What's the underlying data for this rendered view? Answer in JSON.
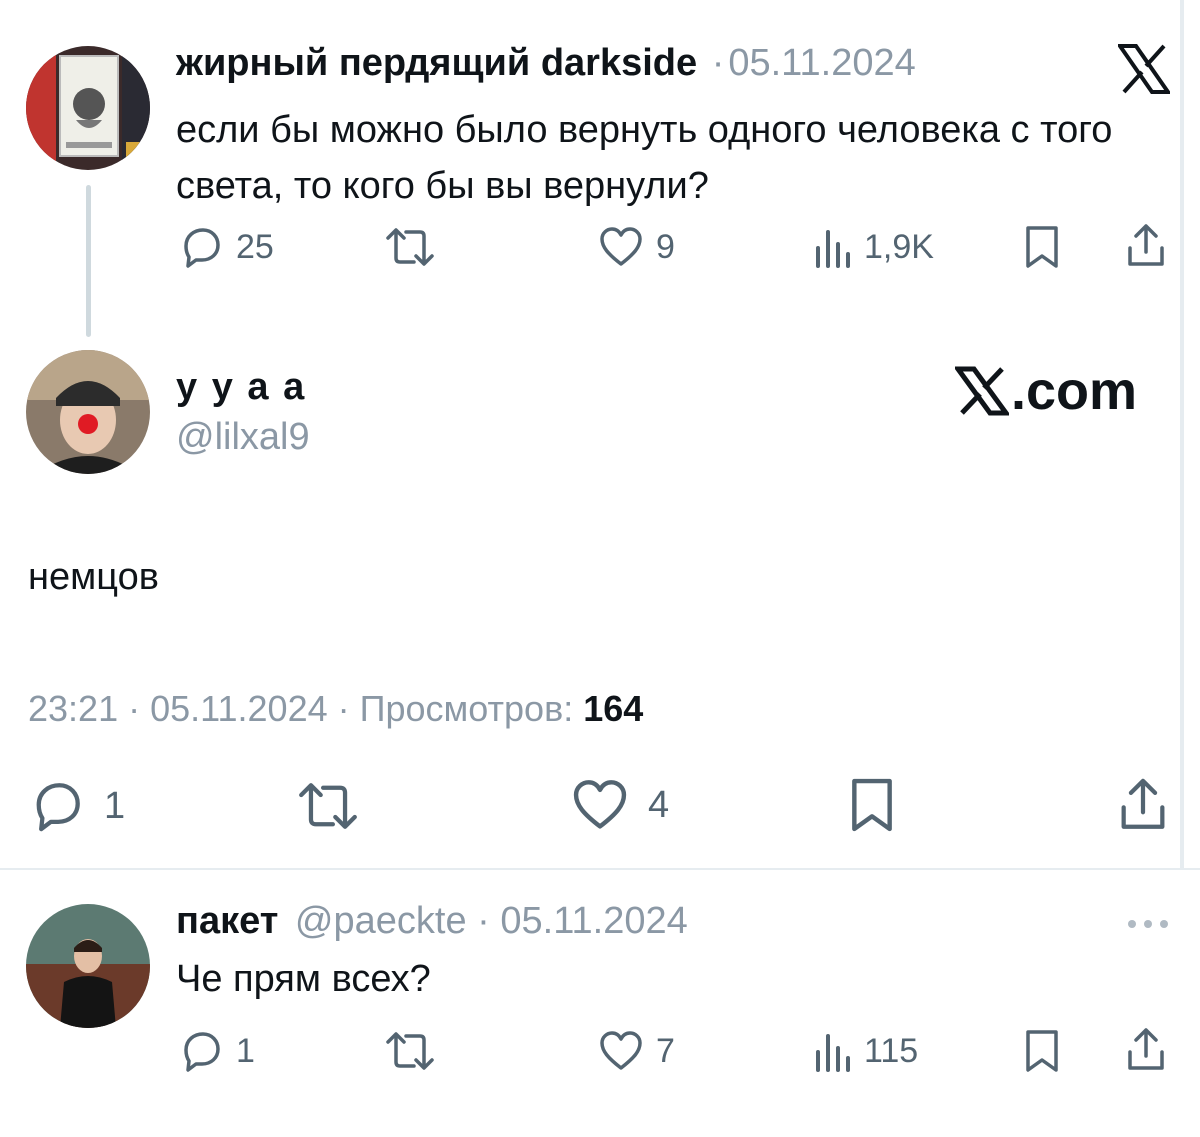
{
  "tweet1": {
    "name": "жирный пердящий darkside",
    "sep": "·",
    "date": "05.11.2024",
    "text": "если бы можно было вернуть одного человека с того света, то кого бы вы вернули?",
    "replies": "25",
    "likes": "9",
    "views": "1,9K"
  },
  "tweet2": {
    "name": "у у а а",
    "handle": "@lilxal9",
    "text": "немцов",
    "time": "23:21",
    "date": "05.11.2024",
    "views_label": "Просмотров:",
    "views": "164",
    "replies": "1",
    "likes": "4"
  },
  "brand": {
    "x_logo": "X",
    "xcom_text": ".com"
  },
  "tweet3": {
    "name": "пакет",
    "handle": "@paeckte",
    "date": "05.11.2024",
    "text": "Че прям всех?",
    "replies": "1",
    "likes": "7",
    "views": "115"
  },
  "icons": [
    "reply-icon",
    "retweet-icon",
    "like-icon",
    "views-icon",
    "bookmark-icon",
    "share-icon",
    "more-icon",
    "x-logo-icon"
  ],
  "colors": {
    "text": "#0f1419",
    "muted": "#536471",
    "line": "#cfd9de"
  }
}
